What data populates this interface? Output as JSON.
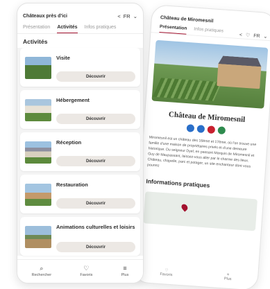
{
  "back_phone": {
    "header_title": "Château de Miromesnil",
    "tabs": [
      {
        "label": "Présentation",
        "active": true
      },
      {
        "label": "Infos pratiques",
        "active": false
      }
    ],
    "lang": "FR",
    "title": "Château de Miromesnil",
    "icon_colors": [
      "#2a6fc9",
      "#2a6fc9",
      "#c8202f",
      "#2e8b4e"
    ],
    "description": "Miromesnil est un château des 16ème et 17ème, où l'on trouve une famille d'une maison de propriétaires privés et d'une demeure historique. Du seigneur Dyel, en passant Marquis de Miromesnil et Guy de Maupassant, laissez-vous aller par le charme des lieux. Château, chapelle, parc et potager, un site enchanteur dont vous pourrez",
    "section": "Informations pratiques",
    "bottom_nav": [
      {
        "label": "Favoris",
        "icon": "heart-icon"
      },
      {
        "label": "Plus",
        "icon": "menu-icon"
      }
    ]
  },
  "front_phone": {
    "header_title": "Châteaux près d'ici",
    "lang": "FR",
    "tabs": [
      {
        "label": "Présentation",
        "active": false
      },
      {
        "label": "Activités",
        "active": true
      },
      {
        "label": "Infos pratiques",
        "active": false
      }
    ],
    "section": "Activités",
    "items": [
      {
        "label": "Visite",
        "button": "Découvrir"
      },
      {
        "label": "Hébergement",
        "button": "Découvrir"
      },
      {
        "label": "Réception",
        "button": "Découvrir"
      },
      {
        "label": "Restauration",
        "button": "Découvrir"
      },
      {
        "label": "Animations culturelles et loisirs",
        "button": "Découvrir"
      }
    ],
    "bottom_nav": [
      {
        "label": "Rechercher",
        "icon": "search-icon"
      },
      {
        "label": "Favoris",
        "icon": "heart-icon"
      },
      {
        "label": "Plus",
        "icon": "menu-icon"
      }
    ]
  },
  "accent_color": "#a3112e"
}
